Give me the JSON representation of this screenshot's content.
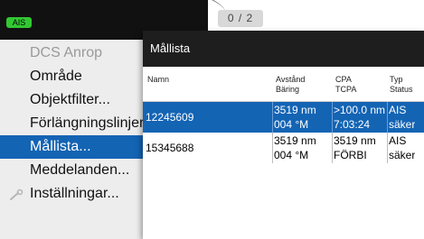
{
  "status": {
    "ais_badge": "AIS",
    "page_indicator": "0 / 2"
  },
  "menu": {
    "items": [
      {
        "label": "DCS Anrop",
        "state": "disabled"
      },
      {
        "label": "Område",
        "state": "normal"
      },
      {
        "label": "Objektfilter...",
        "state": "normal"
      },
      {
        "label": "Förlängningslinjer...",
        "state": "normal"
      },
      {
        "label": "Mållista...",
        "state": "selected"
      },
      {
        "label": "Meddelanden...",
        "state": "normal"
      },
      {
        "label": "Inställningar...",
        "state": "normal",
        "icon": "wrench-icon"
      }
    ]
  },
  "target_list": {
    "title": "Mållista",
    "columns": [
      {
        "lines": [
          "Namn"
        ]
      },
      {
        "lines": [
          "Avstånd",
          "Bäring"
        ]
      },
      {
        "lines": [
          "CPA",
          "TCPA"
        ]
      },
      {
        "lines": [
          "Typ",
          "Status"
        ]
      }
    ],
    "rows": [
      {
        "name": "12245609",
        "distance": "3519 nm",
        "bearing": "004 °M",
        "cpa": ">100.0 nm",
        "tcpa": "7:03:24",
        "type": "AIS",
        "status": "säker",
        "selected": true
      },
      {
        "name": "15345688",
        "distance": "3519 nm",
        "bearing": "004 °M",
        "cpa": "3519 nm",
        "tcpa": "FÖRBI",
        "type": "AIS",
        "status": "säker",
        "selected": false
      }
    ]
  },
  "colors": {
    "selection": "#1464b4",
    "ais_badge": "#32c832",
    "header": "#1e1e1e"
  }
}
